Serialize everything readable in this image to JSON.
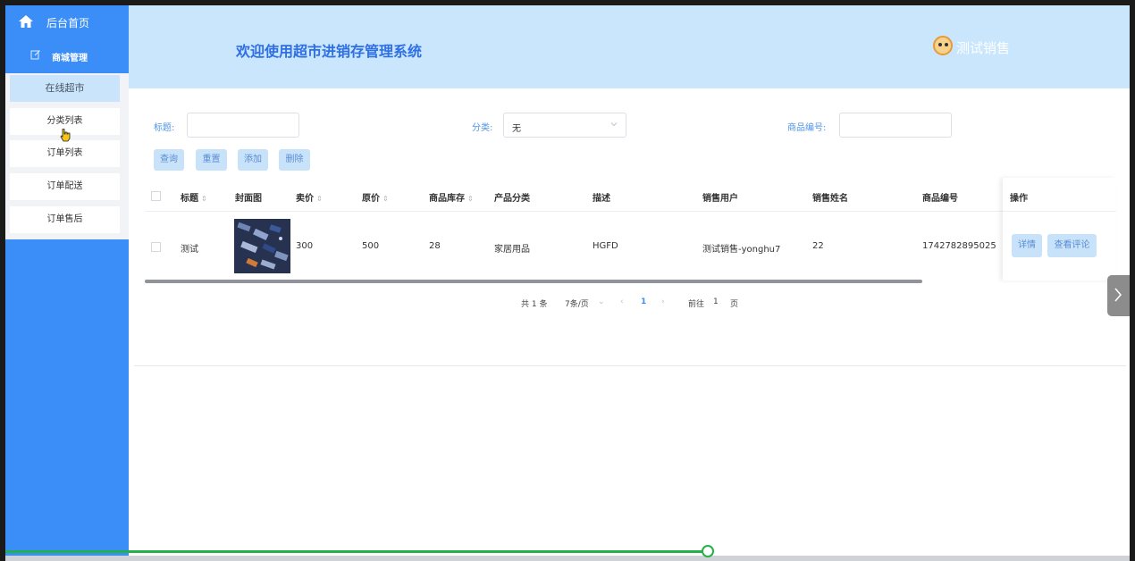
{
  "sidebar": {
    "home_label": "后台首页",
    "group_label": "商城管理",
    "items": [
      {
        "label": "在线超市",
        "active": true
      },
      {
        "label": "分类列表",
        "active": false
      },
      {
        "label": "订单列表",
        "active": false
      },
      {
        "label": "订单配送",
        "active": false
      },
      {
        "label": "订单售后",
        "active": false
      }
    ]
  },
  "header": {
    "title": "欢迎使用超市进销存管理系统",
    "user": "测试销售"
  },
  "search": {
    "title_label": "标题:",
    "title_value": "",
    "category_label": "分类:",
    "category_value": "无",
    "code_label": "商品编号:",
    "code_value": ""
  },
  "toolbar": {
    "query": "查询",
    "reset": "重置",
    "add": "添加",
    "delete": "删除"
  },
  "table": {
    "columns": {
      "title": "标题",
      "cover": "封面图",
      "price": "卖价",
      "orig_price": "原价",
      "stock": "商品库存",
      "category": "产品分类",
      "desc": "描述",
      "seller_user": "销售用户",
      "seller_name": "销售姓名",
      "code": "商品编号",
      "ops": "操作"
    },
    "rows": [
      {
        "title": "测试",
        "price": "300",
        "orig_price": "500",
        "stock": "28",
        "category": "家居用品",
        "desc": "HGFD",
        "seller_user": "测试销售-yonghu7",
        "seller_name": "22",
        "code": "1742782895025",
        "detail": "详情",
        "reviews": "查看评论"
      }
    ]
  },
  "pagination": {
    "total": "共 1 条",
    "page_size": "7条/页",
    "current": "1",
    "goto_label": "前往",
    "goto_value": "1",
    "page_suffix": "页"
  },
  "colors": {
    "sidebar": "#3b8ef7",
    "header": "#c9e6fd",
    "accent": "#2f6fe4",
    "progress": "#26b04a"
  },
  "video_progress": 0.62
}
